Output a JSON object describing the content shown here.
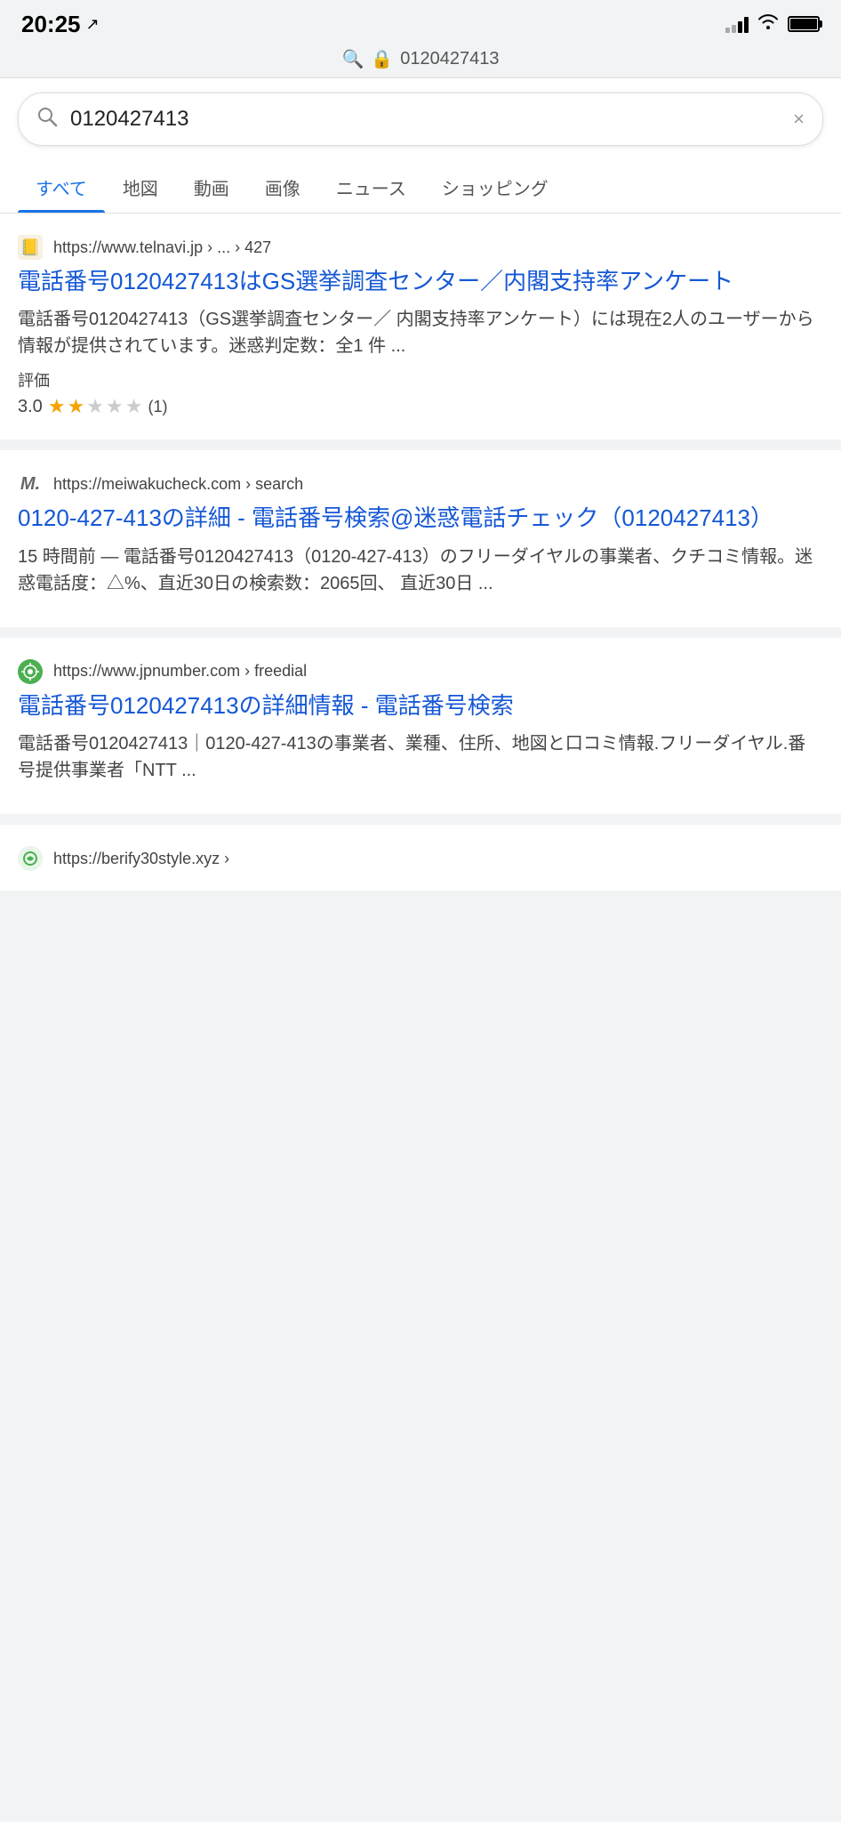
{
  "statusBar": {
    "time": "20:25",
    "locationIcon": "↗"
  },
  "urlBar": {
    "searchIcon": "🔍",
    "lockIcon": "🔒",
    "url": "0120427413"
  },
  "searchBox": {
    "query": "0120427413",
    "clearLabel": "×",
    "searchIconLabel": "🔍"
  },
  "tabs": [
    {
      "label": "すべて",
      "active": true
    },
    {
      "label": "地図",
      "active": false
    },
    {
      "label": "動画",
      "active": false
    },
    {
      "label": "画像",
      "active": false
    },
    {
      "label": "ニュース",
      "active": false
    },
    {
      "label": "ショッピング",
      "active": false
    }
  ],
  "results": [
    {
      "id": "result1",
      "faviconType": "telnavi",
      "faviconEmoji": "📒",
      "siteUrl": "https://www.telnavi.jp › ... › 427",
      "title": "電話番号0120427413はGS選挙調査センター／内閣支持率アンケート",
      "snippet": "電話番号0120427413（GS選挙調査センター／ 内閣支持率アンケート）には現在2人のユーザーから情報が提供されています。迷惑判定数：全1 件 ...",
      "ratingLabel": "評価",
      "ratingScore": "3.0",
      "ratingCount": "(1)",
      "stars": [
        true,
        true,
        false,
        false,
        false
      ]
    },
    {
      "id": "result2",
      "faviconType": "meiwaku",
      "faviconText": "M.",
      "siteUrl": "https://meiwakucheck.com › search",
      "title": "0120-427-413の詳細 - 電話番号検索@迷惑電話チェック（0120427413）",
      "snippet": "15 時間前 — 電話番号0120427413（0120-427-413）のフリーダイヤルの事業者、クチコミ情報。迷惑電話度：△%、直近30日の検索数：2065回、 直近30日 ...",
      "ratingLabel": null,
      "ratingScore": null,
      "ratingCount": null,
      "stars": null
    },
    {
      "id": "result3",
      "faviconType": "jpnumber",
      "faviconText": "Q",
      "siteUrl": "https://www.jpnumber.com › freedial",
      "title": "電話番号0120427413の詳細情報 - 電話番号検索",
      "snippet": "電話番号0120427413｜0120-427-413の事業者、業種、住所、地図と口コミ情報.フリーダイヤル.番号提供事業者「NTT ...",
      "ratingLabel": null,
      "ratingScore": null,
      "ratingCount": null,
      "stars": null
    },
    {
      "id": "result4",
      "faviconType": "berify",
      "faviconText": "C",
      "siteUrl": "https://berify30style.xyz ›",
      "title": "",
      "snippet": "",
      "ratingLabel": null,
      "ratingScore": null,
      "ratingCount": null,
      "stars": null
    }
  ],
  "homeIndicator": ""
}
